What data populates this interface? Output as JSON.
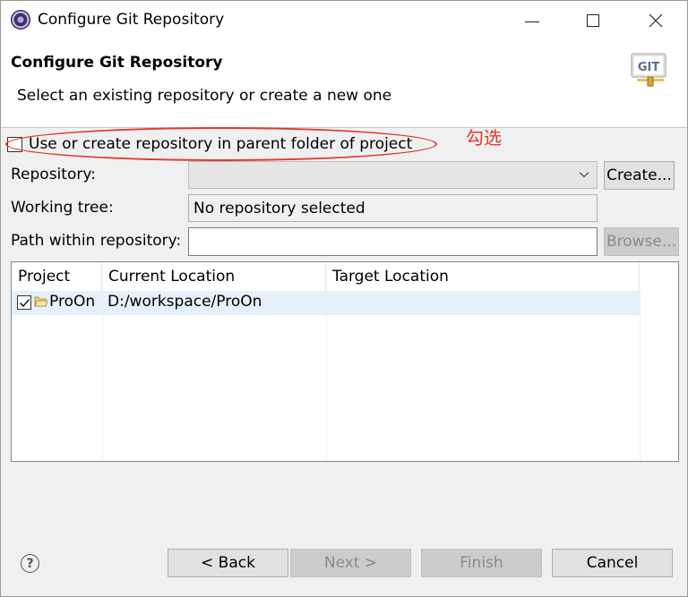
{
  "window": {
    "title": "Configure Git Repository"
  },
  "header": {
    "title": "Configure Git Repository",
    "description": "Select an existing repository or create a new one",
    "logo_text": "GIT"
  },
  "form": {
    "parent_folder_checkbox_label": "Use or create repository in parent folder of project",
    "parent_folder_checked": false,
    "repository_label": "Repository:",
    "repository_value": "",
    "create_button": "Create...",
    "working_tree_label": "Working tree:",
    "working_tree_value": "No repository selected",
    "path_label": "Path within repository:",
    "path_value": "",
    "browse_button": "Browse..."
  },
  "annotation": {
    "text": "勾选",
    "color": "#e23a2c"
  },
  "table": {
    "columns": [
      "Project",
      "Current Location",
      "Target Location"
    ],
    "rows": [
      {
        "checked": true,
        "project": "ProOn",
        "current_location": "D:/workspace/ProOn",
        "target_location": ""
      }
    ]
  },
  "footer": {
    "back": "< Back",
    "next": "Next >",
    "finish": "Finish",
    "cancel": "Cancel"
  },
  "icons": {
    "app": "eclipse-icon",
    "help": "help-icon",
    "folder": "folder-icon"
  }
}
